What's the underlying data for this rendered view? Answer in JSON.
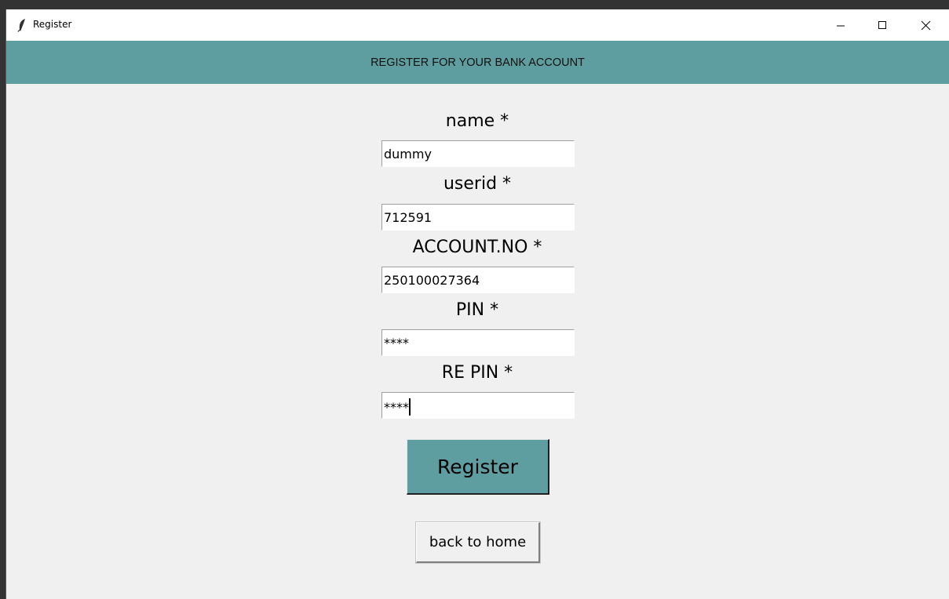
{
  "window": {
    "title": "Register",
    "controls": {
      "minimize": "minimize-icon",
      "maximize": "maximize-icon",
      "close": "close-icon"
    }
  },
  "header": {
    "title": "REGISTER FOR YOUR BANK ACCOUNT",
    "background": "#5f9ea0"
  },
  "form": {
    "fields": [
      {
        "label": "name *",
        "value": "dummy"
      },
      {
        "label": "userid *",
        "value": "712591"
      },
      {
        "label": "ACCOUNT.NO *",
        "value": "250100027364"
      },
      {
        "label": "PIN *",
        "value": "****"
      },
      {
        "label": "RE PIN *",
        "value": "****"
      }
    ],
    "focused_field": "RE PIN *"
  },
  "buttons": {
    "register_label": "Register",
    "register_color": "#5f9ea0",
    "back_label": "back to home"
  }
}
